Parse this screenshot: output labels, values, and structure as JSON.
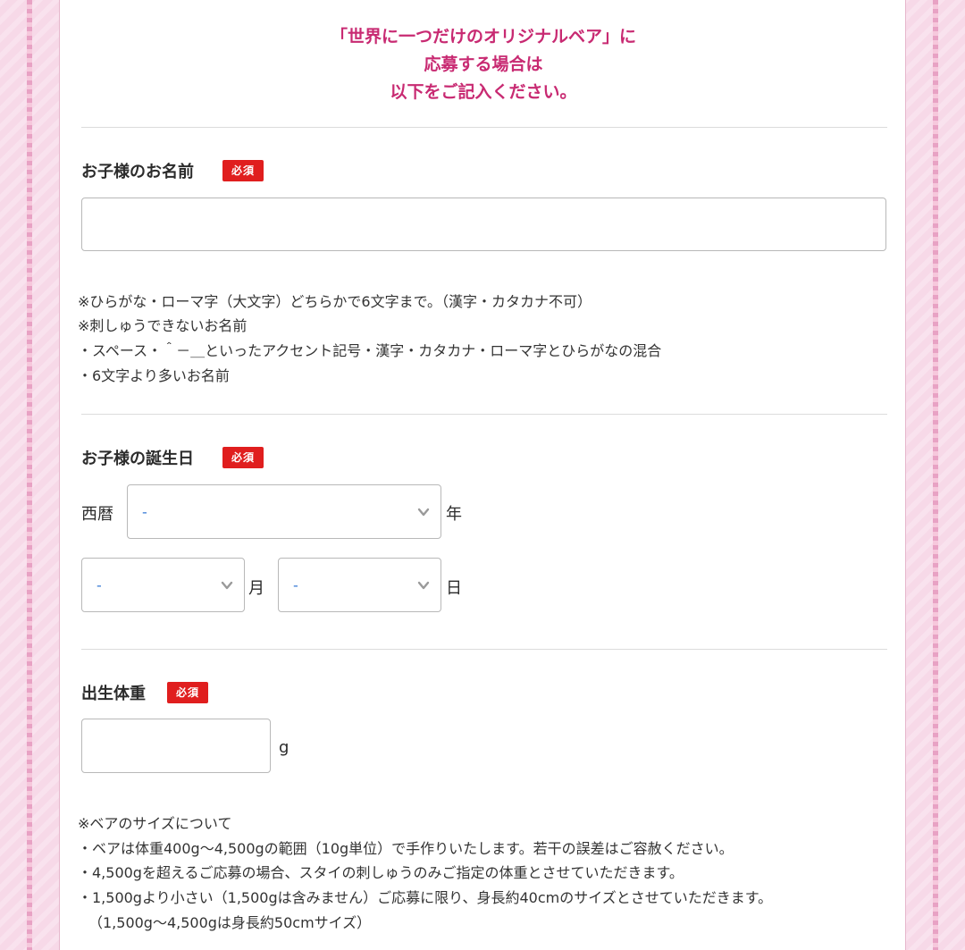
{
  "header": {
    "line1": "「世界に一つだけのオリジナルベア」に",
    "line2": "応募する場合は",
    "line3": "以下をご記入ください。"
  },
  "required_badge": "必須",
  "child_name": {
    "label": "お子様のお名前",
    "value": "",
    "notes": [
      "※ひらがな・ローマ字（大文字）どちらかで6文字まで。（漢字・カタカナ不可）",
      "※刺しゅうできないお名前",
      "・スペース・＾－＿といったアクセント記号・漢字・カタカナ・ローマ字とひらがなの混合",
      "・6文字より多いお名前"
    ]
  },
  "birthday": {
    "label": "お子様の誕生日",
    "era_label": "西暦",
    "year_value": "-",
    "year_unit": "年",
    "month_value": "-",
    "month_unit": "月",
    "day_value": "-",
    "day_unit": "日"
  },
  "birth_weight": {
    "label": "出生体重",
    "value": "",
    "unit": "g",
    "notes": [
      "※ベアのサイズについて",
      "・ベアは体重400g～4,500gの範囲（10g単位）で手作りいたします。若干の誤差はご容赦ください。",
      "・4,500gを超えるご応募の場合、スタイの刺しゅうのみご指定の体重とさせていただきます。",
      "・1,500gより小さい（1,500gは含みません）ご応募に限り、身長約40cmのサイズとさせていただきます。",
      "（1,500g～4,500gは身長約50cmサイズ）"
    ]
  },
  "colors": {
    "heading": "#c82a72",
    "badge": "#e01e1e",
    "select_value": "#3a7bd5",
    "background": "#f7d9e8"
  },
  "icons": {
    "select_chevron": "chevron-down-icon"
  }
}
